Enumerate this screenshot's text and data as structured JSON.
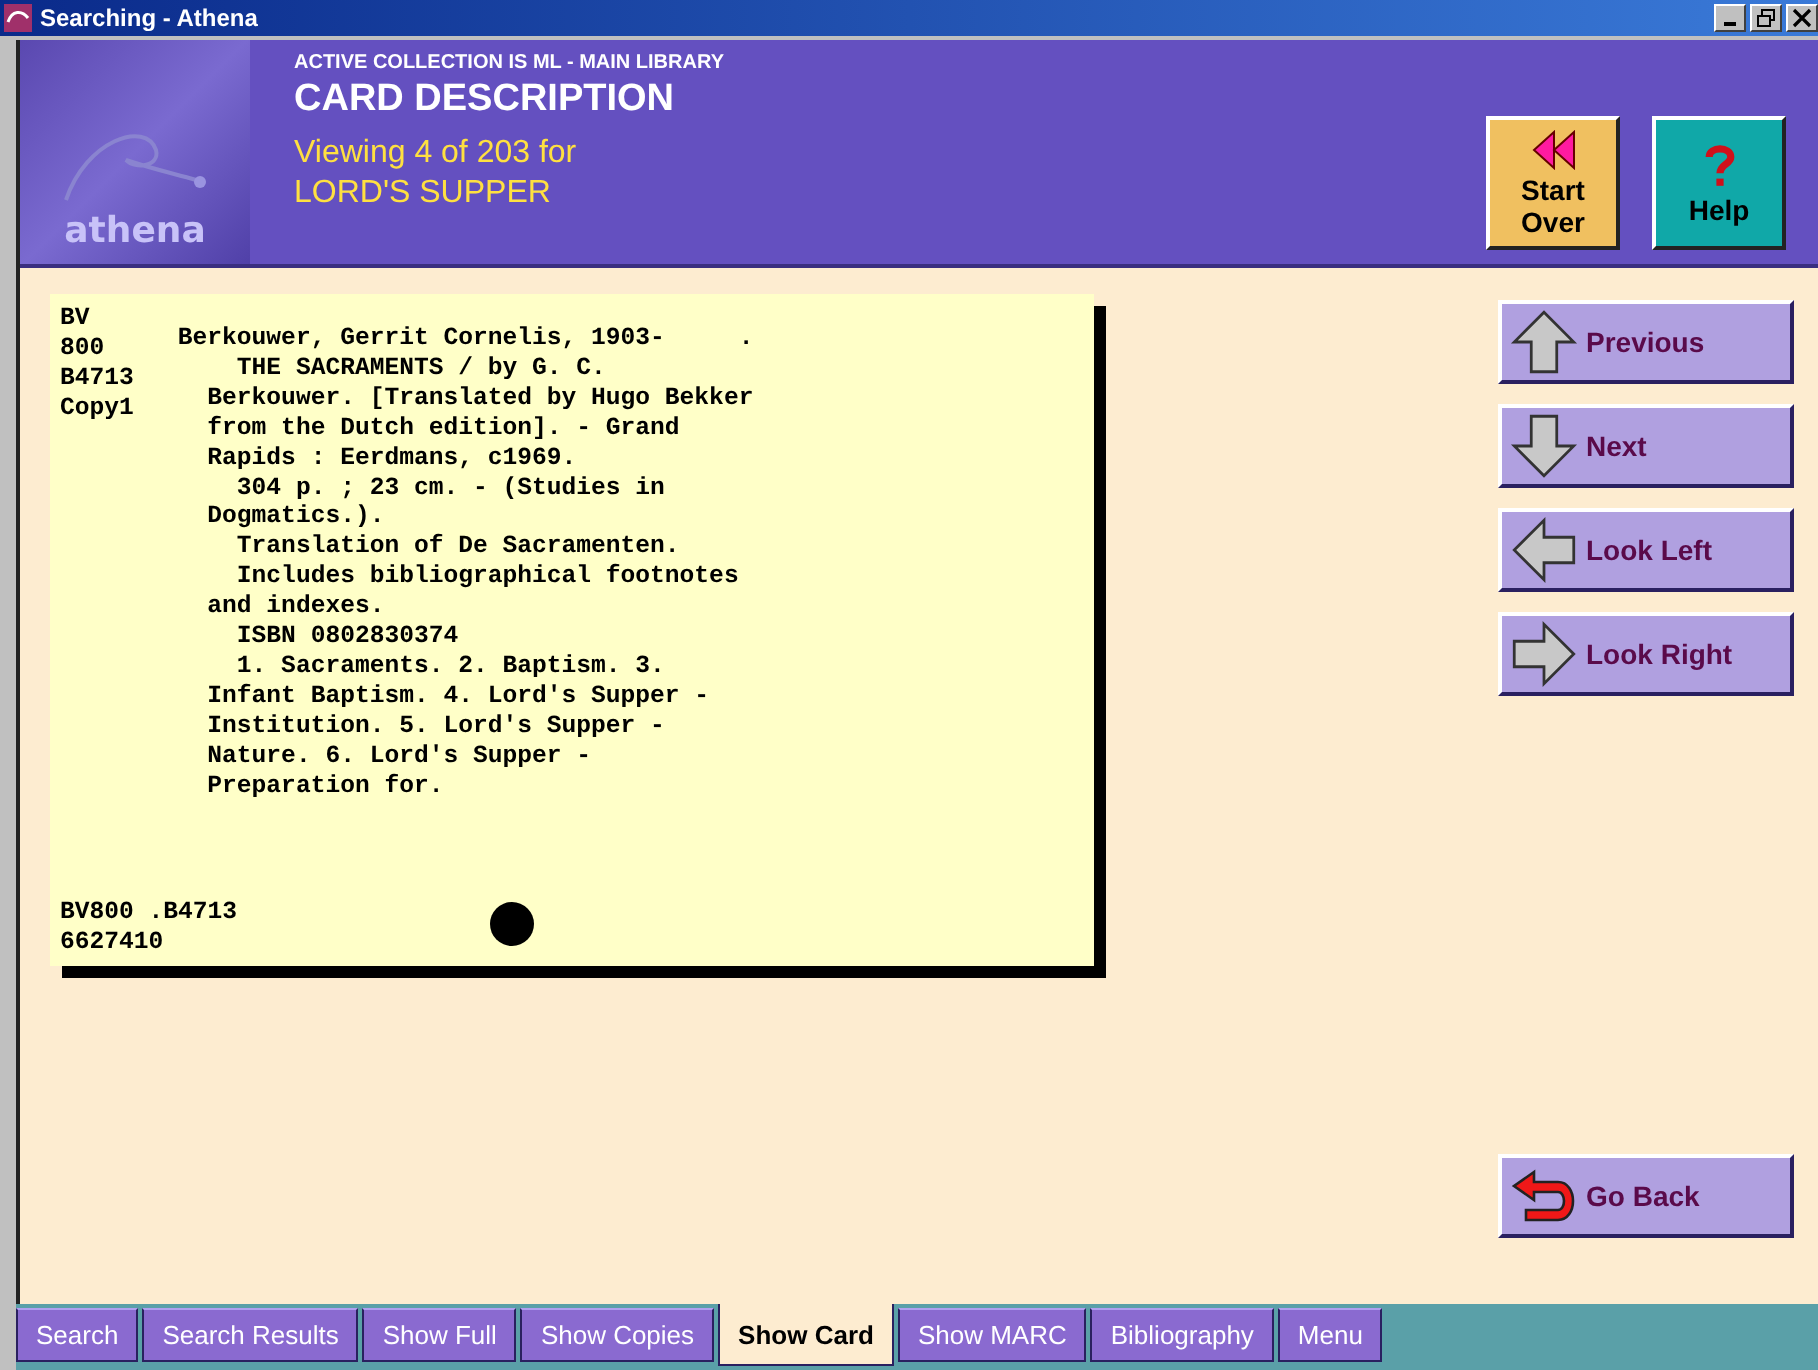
{
  "window": {
    "title": "Searching - Athena"
  },
  "header": {
    "logo_text": "athena",
    "collection": "ACTIVE COLLECTION IS ML - MAIN LIBRARY",
    "heading": "CARD DESCRIPTION",
    "viewing": "Viewing 4 of 203 for",
    "query": "LORD'S SUPPER"
  },
  "header_buttons": [
    {
      "kind": "rewind",
      "label": "Start\nOver"
    },
    {
      "kind": "help",
      "label": "Help"
    }
  ],
  "card": {
    "call_number": "BV\n800\nB4713\nCopy1",
    "description": "Berkouwer, Gerrit Cornelis, 1903-     .\n    THE SACRAMENTS / by G. C.\n  Berkouwer. [Translated by Hugo Bekker\n  from the Dutch edition]. - Grand\n  Rapids : Eerdmans, c1969.\n    304 p. ; 23 cm. - (Studies in\n  Dogmatics.).\n    Translation of De Sacramenten.\n    Includes bibliographical footnotes\n  and indexes.\n    ISBN 0802830374\n    1. Sacraments. 2. Baptism. 3.\n  Infant Baptism. 4. Lord's Supper -\n  Institution. 5. Lord's Supper -\n  Nature. 6. Lord's Supper -\n  Preparation for.",
    "footer": "BV800 .B4713\n6627410"
  },
  "nav_buttons": [
    {
      "kind": "up",
      "label": "Previous"
    },
    {
      "kind": "down",
      "label": "Next"
    },
    {
      "kind": "left",
      "label": "Look Left"
    },
    {
      "kind": "right",
      "label": "Look Right"
    }
  ],
  "back_button": {
    "label": "Go Back"
  },
  "tabs": [
    {
      "label": "Search",
      "selected": false
    },
    {
      "label": "Search Results",
      "selected": false
    },
    {
      "label": "Show Full",
      "selected": false
    },
    {
      "label": "Show Copies",
      "selected": false
    },
    {
      "label": "Show Card",
      "selected": true
    },
    {
      "label": "Show MARC",
      "selected": false
    },
    {
      "label": "Bibliography",
      "selected": false
    },
    {
      "label": "Menu",
      "selected": false
    }
  ]
}
